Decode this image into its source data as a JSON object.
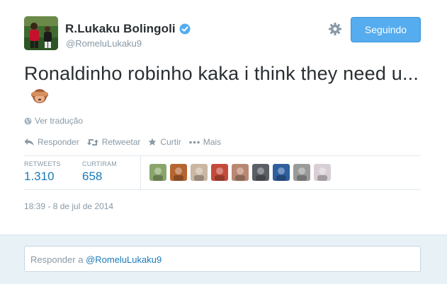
{
  "author": {
    "fullname": "R.Lukaku Bolingoli",
    "screenname": "@RomeluLukaku9",
    "verified": true,
    "avatar_icon": "player-avatar"
  },
  "header": {
    "settings_icon": "gear-icon",
    "follow_label": "Seguindo"
  },
  "tweet": {
    "text": "Ronaldinho robinho kaka i think they need u...",
    "emoji": "see-no-evil-monkey",
    "translate_label": "Ver tradução"
  },
  "actions": {
    "reply_label": "Responder",
    "retweet_label": "Retweetar",
    "like_label": "Curtir",
    "more_label": "Mais"
  },
  "stats": {
    "retweets_label": "RETWEETS",
    "retweets_value": "1.310",
    "likes_label": "CURTIRAM",
    "likes_value": "658",
    "liker_avatars": [
      "#8aa56b",
      "#b5652f",
      "#c9b7a3",
      "#c44b3a",
      "#b98873",
      "#5a5f66",
      "#2f5f9e",
      "#9a9a9a",
      "#d8cfd6"
    ]
  },
  "timestamp": "18:39 - 8 de jul de 2014",
  "reply": {
    "placeholder_prefix": "Responder a ",
    "mention": "@RomeluLukaku9"
  },
  "colors": {
    "accent": "#55acee",
    "link": "#1a7ab8",
    "muted": "#8899a6",
    "reply_bg": "#e8f1f6"
  }
}
